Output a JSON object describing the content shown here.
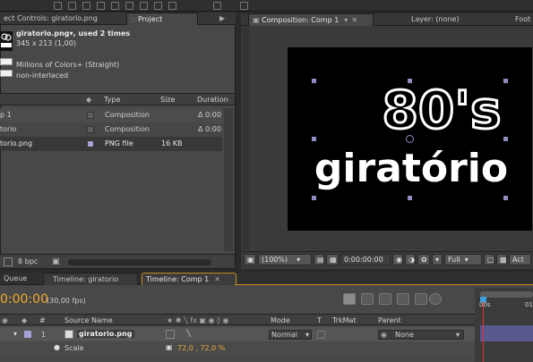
{
  "tabs_top": {
    "effect_controls": "ect Controls: giratorio.png",
    "project": "Project"
  },
  "project": {
    "file_name": "giratorio.png",
    "used_suffix": "▾, used 2 times",
    "dimensions": "345 x 213 (1,00)",
    "colors": "Millions of Colors+ (Straight)",
    "interlace": "non-interlaced",
    "columns": {
      "type": "Type",
      "size": "Size",
      "duration": "Duration"
    },
    "rows": [
      {
        "name": "p 1",
        "type": "Composition",
        "size": "",
        "duration": "Δ 0:00"
      },
      {
        "name": "torio",
        "type": "Composition",
        "size": "",
        "duration": "Δ 0:00"
      },
      {
        "name": "torio.png",
        "type": "PNG file",
        "size": "16 KB",
        "duration": ""
      }
    ],
    "bpc": "8 bpc"
  },
  "comp_viewer": {
    "tab_composition": "Composition: Comp 1",
    "tab_layer": "Layer: (none)",
    "tab_foot": "Foot",
    "logo_top": "80's",
    "logo_bottom": "giratório",
    "zoom": "(100%)",
    "timecode": "0:00:00:00",
    "resolution": "Full",
    "act": "Act"
  },
  "timeline": {
    "tab_queue": "Queue",
    "tab_giratorio": "Timeline: giratorio",
    "tab_comp1": "Timeline: Comp 1",
    "timecode": "0:00:00",
    "fps": "(30,00 fps)",
    "col_source": "Source Name",
    "col_mode": "Mode",
    "col_t": "T",
    "col_trkmat": "TrkMat",
    "col_parent": "Parent",
    "layer_num": "1",
    "layer_name": "giratorio.png",
    "mode_value": "Normal",
    "parent_value": "None",
    "prop_name": "Scale",
    "prop_value": "72,0 , 72,0 %",
    "ruler_0": "00s",
    "ruler_1": "01"
  }
}
